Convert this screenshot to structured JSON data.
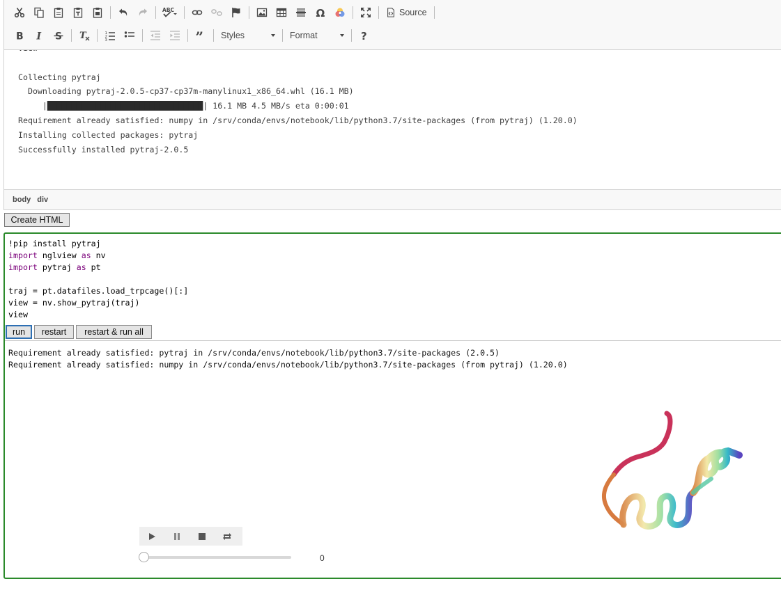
{
  "toolbar": {
    "row1": [
      "cut-icon",
      "copy-icon",
      "paste-icon",
      "paste-text-icon",
      "paste-word-icon",
      "undo-icon",
      "redo-icon",
      "spellcheck-icon",
      "link-icon",
      "unlink-icon",
      "anchor-icon",
      "image-icon",
      "table-icon",
      "horizontal-line-icon",
      "special-char-icon",
      "color-icon",
      "maximize-icon",
      "source-icon"
    ],
    "source_label": "Source",
    "styles_label": "Styles",
    "format_label": "Format"
  },
  "editor": {
    "lines": [
      "view",
      "",
      "Collecting pytraj",
      "  Downloading pytraj-2.0.5-cp37-cp37m-manylinux1_x86_64.whl (16.1 MB)",
      "     |████████████████████████████████| 16.1 MB 4.5 MB/s eta 0:00:01",
      "Requirement already satisfied: numpy in /srv/conda/envs/notebook/lib/python3.7/site-packages (from pytraj) (1.20.0)",
      "Installing collected packages: pytraj",
      "Successfully installed pytraj-2.0.5"
    ],
    "path": [
      "body",
      "div"
    ]
  },
  "create_button": "Create HTML",
  "cell": {
    "code": [
      [
        {
          "t": "!pip install pytraj"
        }
      ],
      [
        {
          "t": "import",
          "k": true
        },
        {
          "t": " nglview "
        },
        {
          "t": "as",
          "k": true
        },
        {
          "t": " nv"
        }
      ],
      [
        {
          "t": "import",
          "k": true
        },
        {
          "t": " pytraj "
        },
        {
          "t": "as",
          "k": true
        },
        {
          "t": " pt"
        }
      ],
      [
        {
          "t": ""
        }
      ],
      [
        {
          "t": "traj = pt.datafiles.load_trpcage()[:]"
        }
      ],
      [
        {
          "t": "view = nv.show_pytraj(traj)"
        }
      ],
      [
        {
          "t": "view"
        }
      ]
    ],
    "buttons": {
      "run": "run",
      "restart": "restart",
      "restart_all": "restart & run all"
    },
    "output": [
      "Requirement already satisfied: pytraj in /srv/conda/envs/notebook/lib/python3.7/site-packages (2.0.5)",
      "Requirement already satisfied: numpy in /srv/conda/envs/notebook/lib/python3.7/site-packages (from pytraj) (1.20.0)"
    ],
    "player": {
      "frame_value": "0",
      "slider_fraction": 0
    }
  }
}
